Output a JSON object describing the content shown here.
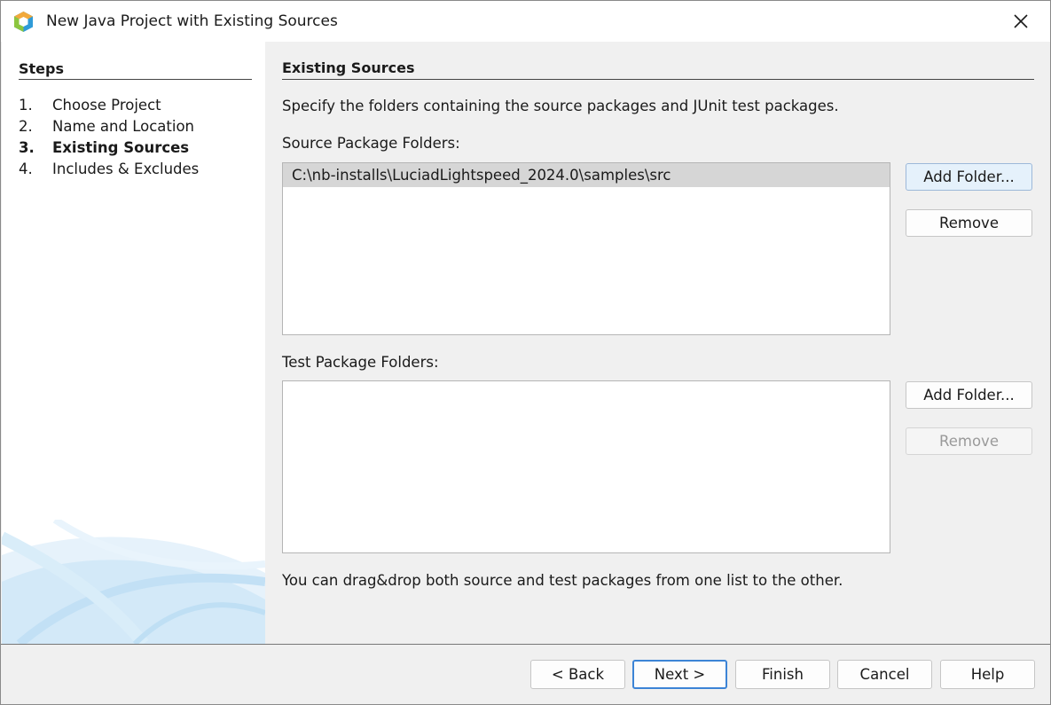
{
  "window": {
    "title": "New Java Project with Existing Sources",
    "icon": "netbeans-cube-icon"
  },
  "steps": {
    "title": "Steps",
    "items": [
      {
        "num": "1.",
        "label": "Choose Project"
      },
      {
        "num": "2.",
        "label": "Name and Location"
      },
      {
        "num": "3.",
        "label": "Existing Sources",
        "current": true
      },
      {
        "num": "4.",
        "label": "Includes & Excludes"
      }
    ]
  },
  "content": {
    "heading": "Existing Sources",
    "description": "Specify the folders containing the source packages and JUnit test packages.",
    "source_label": "Source Package Folders:",
    "source_folders": [
      "C:\\nb-installs\\LuciadLightspeed_2024.0\\samples\\src"
    ],
    "source_add": "Add Folder...",
    "source_remove": "Remove",
    "test_label": "Test Package Folders:",
    "test_folders": [],
    "test_add": "Add Folder...",
    "test_remove": "Remove",
    "hint": "You can drag&drop both source and test packages from one list to the other."
  },
  "footer": {
    "back": "< Back",
    "next": "Next >",
    "finish": "Finish",
    "cancel": "Cancel",
    "help": "Help"
  },
  "colors": {
    "accent": "#3c84d6",
    "selected_row": "#d6d6d6",
    "focused_button": "#e5f1fb"
  }
}
